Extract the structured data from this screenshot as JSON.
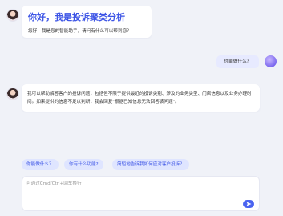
{
  "greeting": {
    "title": "你好，我是投诉聚类分析",
    "subtitle": "您好！我是您的智能助手，请问有什么可以帮到您？"
  },
  "user_message": {
    "text": "你能做什么？"
  },
  "bot_answer": {
    "text": "我可以帮助解答客户的投诉问题，包括但不限于提供最近的投诉类别、涉及的业务类型、门店信息以及业务办理时间。如果提供的信息不足以判断，我会回复\"根据已知信息无法回答该问题\"。"
  },
  "suggestions": [
    {
      "label": "你能做什么？"
    },
    {
      "label": "你有什么功能?"
    },
    {
      "label": "简短地告诉我如何应对客户投诉？"
    }
  ],
  "composer": {
    "placeholder": "可通过Cmd/Ctrl+回车换行",
    "value": ""
  },
  "colors": {
    "accent": "#3d55e6",
    "page_bg": "#f0f2f8",
    "user_bubble": "#e7eaff",
    "chip_bg": "#dfe5ff"
  },
  "icons": {
    "bot_avatar": "bot-avatar-icon",
    "user_avatar": "user-avatar-icon",
    "send": "send-icon"
  }
}
